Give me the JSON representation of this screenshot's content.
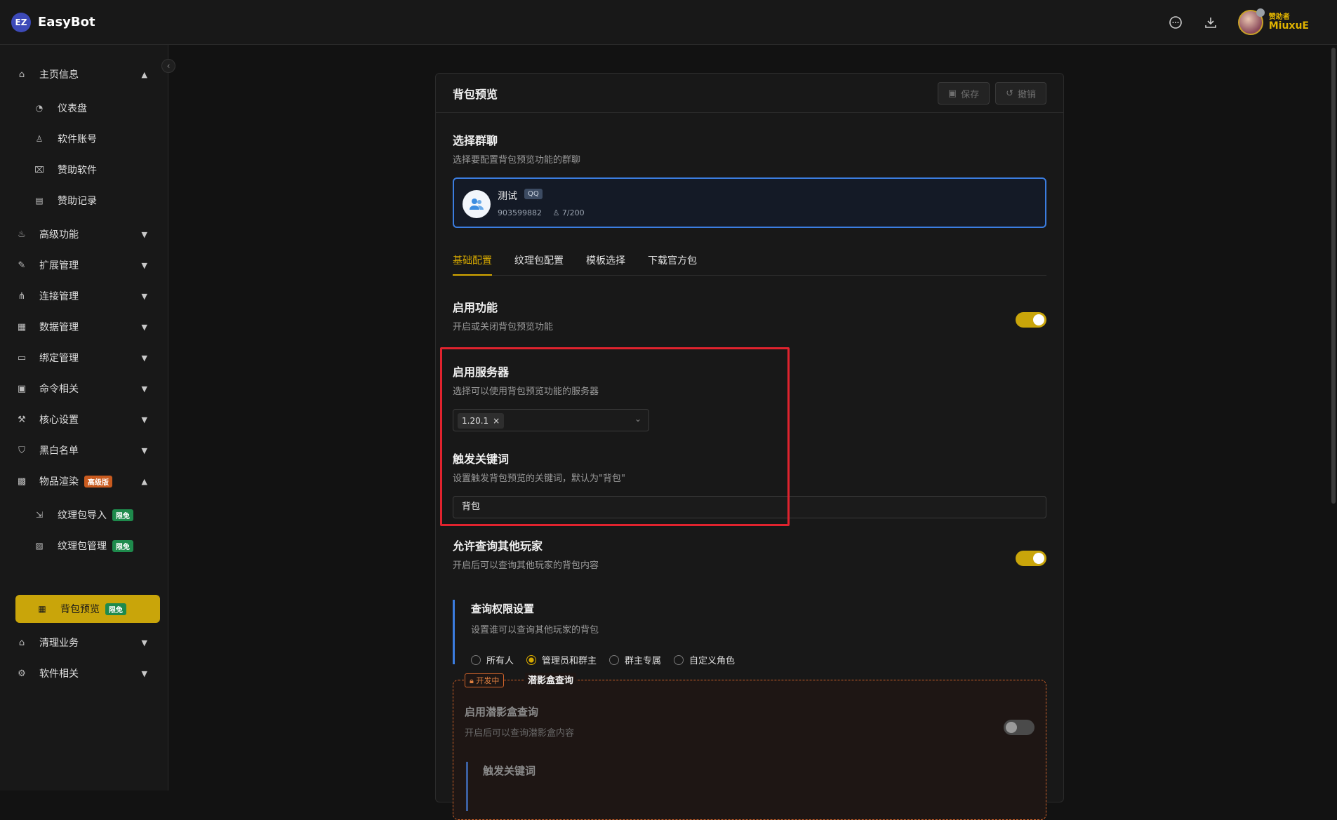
{
  "app": {
    "logo_badge": "EZ",
    "title": "EasyBot"
  },
  "user": {
    "role": "赞助者",
    "name": "MiuxuE"
  },
  "sidebar": {
    "items": [
      {
        "label": "主页信息"
      },
      {
        "label": "仪表盘"
      },
      {
        "label": "软件账号"
      },
      {
        "label": "赞助软件"
      },
      {
        "label": "赞助记录"
      },
      {
        "label": "高级功能"
      },
      {
        "label": "扩展管理"
      },
      {
        "label": "连接管理"
      },
      {
        "label": "数据管理"
      },
      {
        "label": "绑定管理"
      },
      {
        "label": "命令相关"
      },
      {
        "label": "核心设置"
      },
      {
        "label": "黑白名单"
      },
      {
        "label": "物品渲染",
        "tag": "高级版"
      },
      {
        "label": "纹理包导入",
        "tag": "限免"
      },
      {
        "label": "纹理包管理",
        "tag": "限免"
      },
      {
        "label": "背包预览",
        "tag": "限免"
      },
      {
        "label": "清理业务"
      },
      {
        "label": "软件相关"
      }
    ]
  },
  "panel": {
    "title": "背包预览",
    "save_label": "保存",
    "undo_label": "撤销"
  },
  "group_select": {
    "title": "选择群聊",
    "desc": "选择要配置背包预览功能的群聊",
    "group_name": "测试",
    "group_tag": "QQ",
    "group_id": "903599882",
    "members": "7/200"
  },
  "tabs": [
    "基础配置",
    "纹理包配置",
    "模板选择",
    "下载官方包"
  ],
  "enable": {
    "title": "启用功能",
    "desc": "开启或关闭背包预览功能"
  },
  "servers": {
    "title": "启用服务器",
    "desc": "选择可以使用背包预览功能的服务器",
    "selected": "1.20.1"
  },
  "keyword": {
    "title": "触发关键词",
    "desc": "设置触发背包预览的关键词，默认为\"背包\"",
    "value": "背包"
  },
  "allow_query": {
    "title": "允许查询其他玩家",
    "desc": "开启后可以查询其他玩家的背包内容"
  },
  "permission": {
    "title": "查询权限设置",
    "desc": "设置谁可以查询其他玩家的背包",
    "options": [
      "所有人",
      "管理员和群主",
      "群主专属",
      "自定义角色"
    ]
  },
  "shulker": {
    "dev_tag": "开发中",
    "box_title": "潜影盒查询",
    "enable_title": "启用潜影盒查询",
    "enable_desc": "开启后可以查询潜影盒内容",
    "keyword_title": "触发关键词"
  }
}
